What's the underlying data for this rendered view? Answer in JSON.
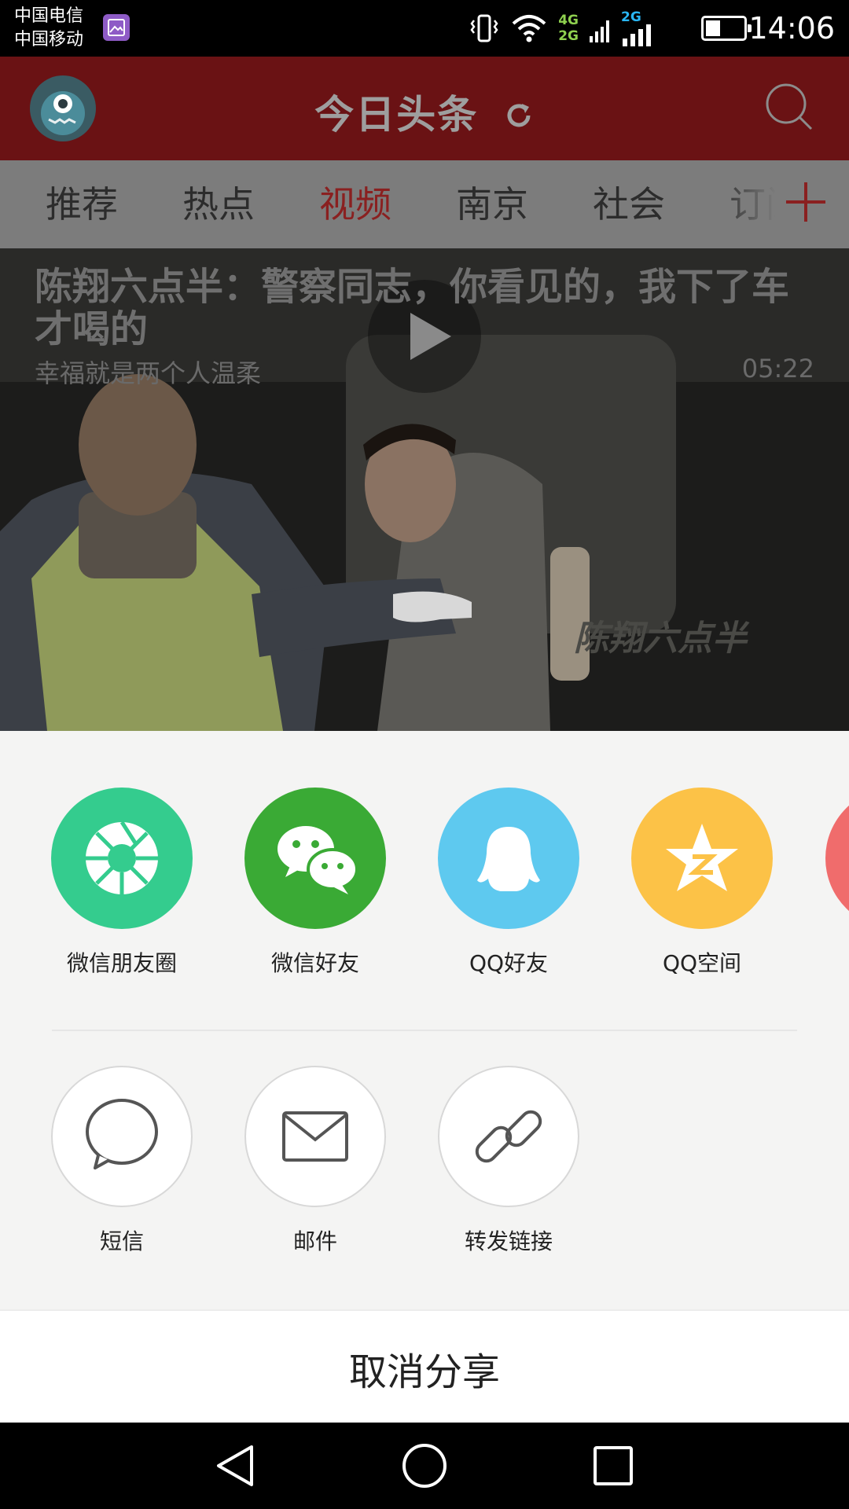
{
  "status_bar": {
    "carrier_1": "中国电信",
    "carrier_2": "中国移动",
    "net_top": "4G",
    "net_bottom": "2G",
    "net_2": "2G",
    "time": "14:06",
    "battery_level": 0.4
  },
  "header": {
    "title": "今日头条",
    "refresh_icon": "refresh-icon",
    "search_icon": "search-icon"
  },
  "tabs": {
    "items": [
      {
        "label": "推荐"
      },
      {
        "label": "热点"
      },
      {
        "label": "视频",
        "active": true
      },
      {
        "label": "南京"
      },
      {
        "label": "社会"
      },
      {
        "label": "订阅"
      }
    ],
    "add_icon": "plus-icon"
  },
  "video": {
    "title": "陈翔六点半：警察同志，你看见的，我下了车才喝的",
    "source": "幸福就是两个人温柔",
    "duration": "05:22",
    "watermark": "陈翔六点半"
  },
  "share": {
    "row1": [
      {
        "label": "微信朋友圈",
        "icon": "moments-icon",
        "color": "#34cc8e"
      },
      {
        "label": "微信好友",
        "icon": "wechat-icon",
        "color": "#3aaa35"
      },
      {
        "label": "QQ好友",
        "icon": "qq-icon",
        "color": "#5ec9ef"
      },
      {
        "label": "QQ空间",
        "icon": "qzone-icon",
        "color": "#fcc247"
      },
      {
        "label": "",
        "icon": "weibo-icon",
        "color": "#f06c6c"
      }
    ],
    "row2": [
      {
        "label": "短信",
        "icon": "sms-icon"
      },
      {
        "label": "邮件",
        "icon": "mail-icon"
      },
      {
        "label": "转发链接",
        "icon": "link-icon"
      }
    ],
    "cancel_label": "取消分享"
  },
  "navbar": {
    "back": "back-icon",
    "home": "home-icon",
    "recents": "recents-icon"
  }
}
